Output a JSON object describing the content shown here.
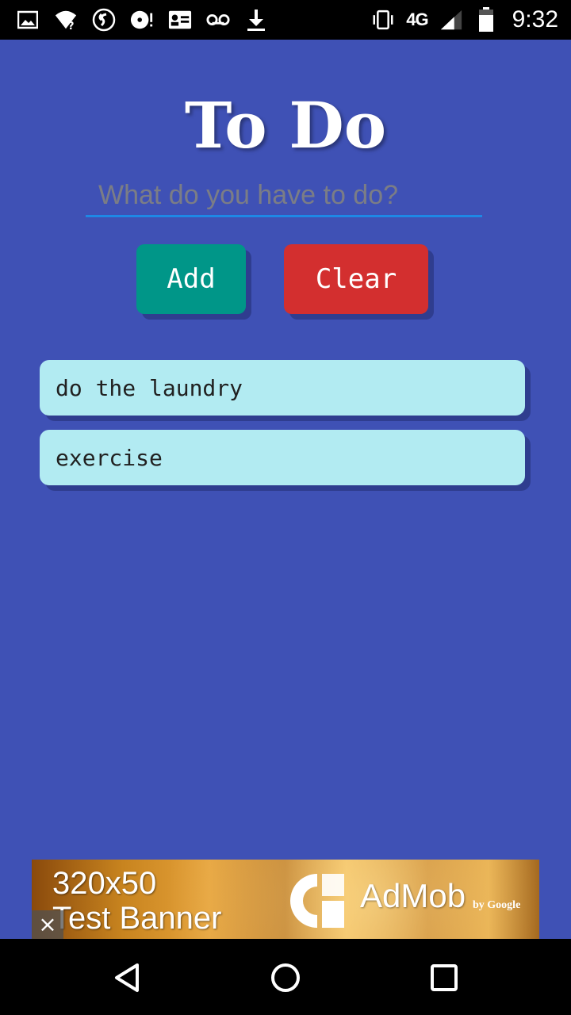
{
  "status_bar": {
    "time": "9:32",
    "network": "4G",
    "left_icons": [
      "image-icon",
      "wifi-unknown-icon",
      "shazam-icon",
      "cd-alert-icon",
      "contact-card-icon",
      "voicemail-icon",
      "download-icon"
    ],
    "right_icons": [
      "vibrate-icon",
      "network-4g-lte-icon",
      "signal-icon",
      "battery-icon"
    ]
  },
  "app": {
    "title": "To Do",
    "input": {
      "placeholder": "What do you have to do?",
      "value": ""
    },
    "add_label": "Add",
    "clear_label": "Clear",
    "items": [
      {
        "text": "do the laundry"
      },
      {
        "text": "exercise"
      }
    ]
  },
  "ad": {
    "size_text": "320x50",
    "banner_text": "Test Banner",
    "brand": "AdMob",
    "by": "by Google",
    "close": "×"
  },
  "colors": {
    "background": "#3f51b5",
    "add_button": "#009688",
    "clear_button": "#d32f2f",
    "item_background": "#b2ebf2",
    "input_underline": "#1e88e5"
  }
}
